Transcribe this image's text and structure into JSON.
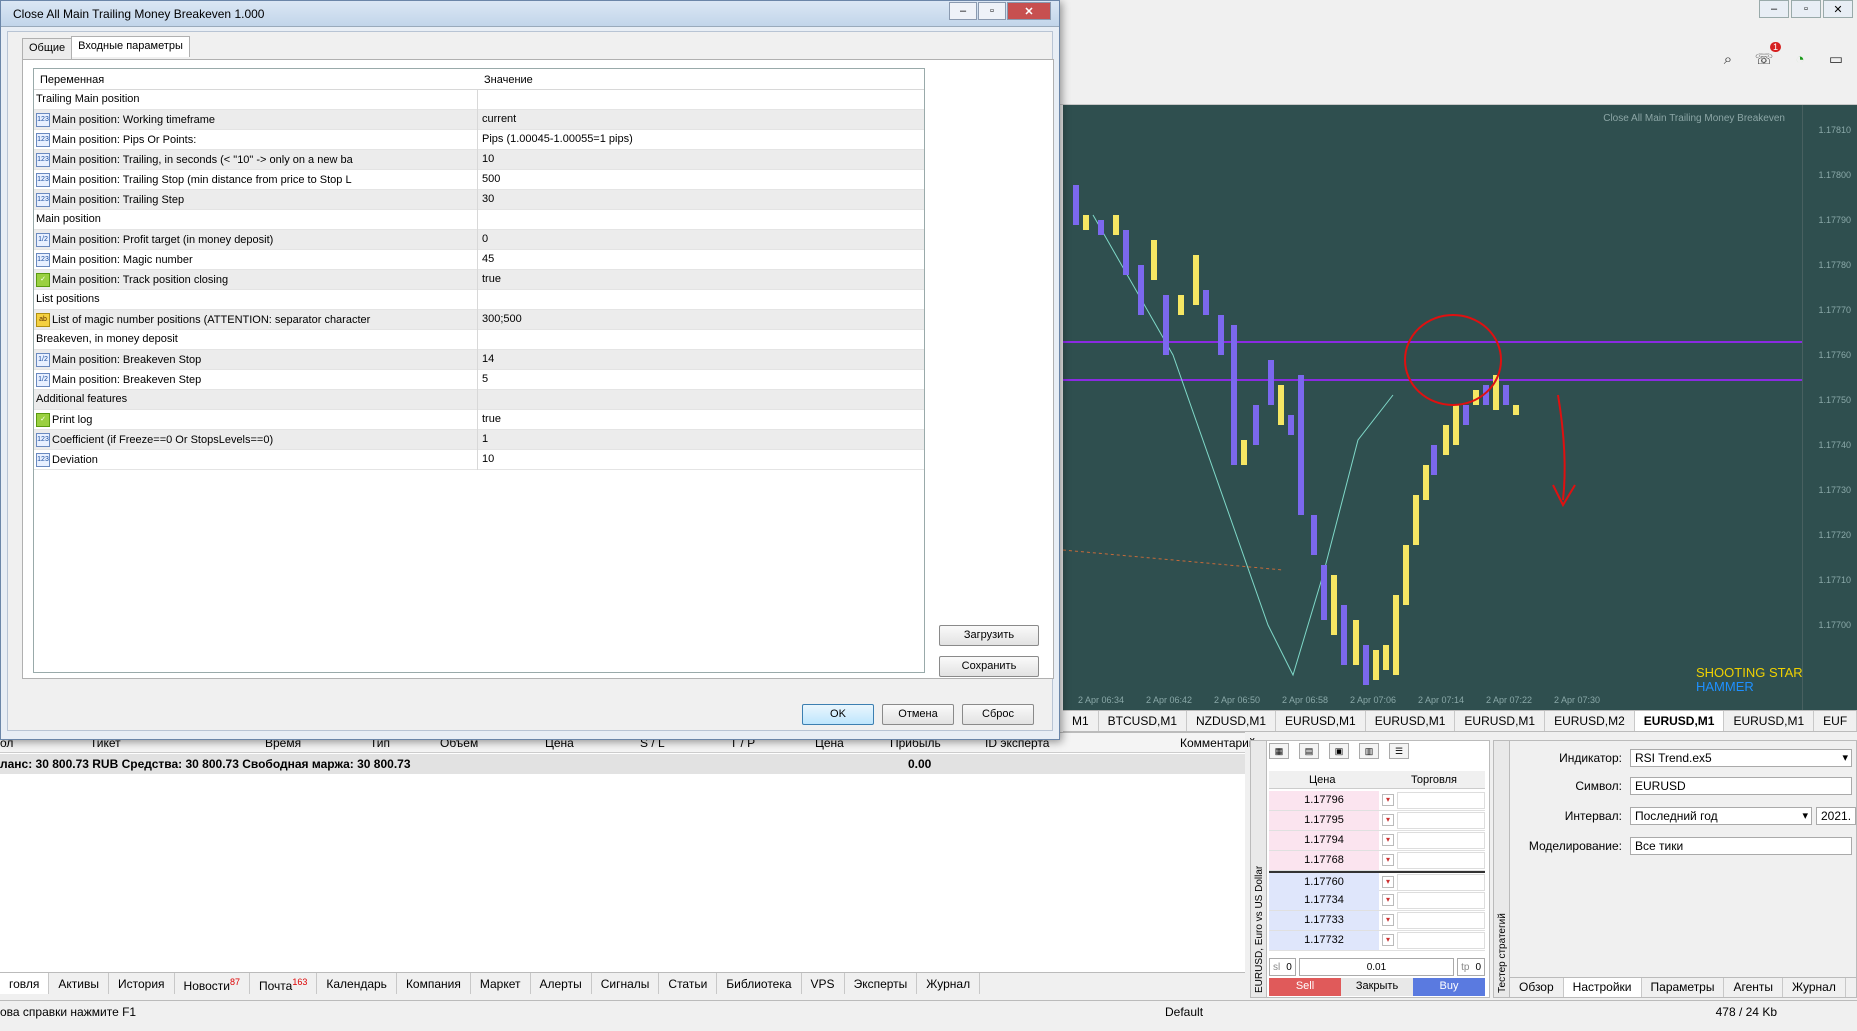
{
  "dialog": {
    "title": "Close All Main Trailing Money Breakeven 1.000",
    "tabs": [
      "Общие",
      "Входные параметры"
    ],
    "columns": {
      "name": "Переменная",
      "value": "Значение"
    },
    "rows": [
      {
        "type": "group",
        "name": "Trailing Main position",
        "value": ""
      },
      {
        "type": "int",
        "name": "Main position: Working timeframe",
        "value": "current"
      },
      {
        "type": "int",
        "name": "Main position: Pips Or Points:",
        "value": "Pips (1.00045-1.00055=1 pips)"
      },
      {
        "type": "int",
        "name": "Main position: Trailing, in seconds (< \"10\" -> only on a new ba",
        "value": "10"
      },
      {
        "type": "int",
        "name": "Main position: Trailing Stop (min distance from price to Stop L",
        "value": "500"
      },
      {
        "type": "int",
        "name": "Main position: Trailing Step",
        "value": "30"
      },
      {
        "type": "group",
        "name": "Main position",
        "value": ""
      },
      {
        "type": "dbl",
        "name": "Main position: Profit target (in money deposit)",
        "value": "0"
      },
      {
        "type": "int",
        "name": "Main position: Magic number",
        "value": "45"
      },
      {
        "type": "bool",
        "name": "Main position: Track position closing",
        "value": "true"
      },
      {
        "type": "group",
        "name": "List positions",
        "value": ""
      },
      {
        "type": "str",
        "name": "List of magic number positions (ATTENTION: separator character",
        "value": "300;500"
      },
      {
        "type": "group",
        "name": "Breakeven, in money deposit",
        "value": ""
      },
      {
        "type": "dbl",
        "name": "Main position: Breakeven Stop",
        "value": "14"
      },
      {
        "type": "dbl",
        "name": "Main position: Breakeven Step",
        "value": "5"
      },
      {
        "type": "group",
        "name": "Additional features",
        "value": ""
      },
      {
        "type": "bool",
        "name": "Print log",
        "value": "true"
      },
      {
        "type": "int",
        "name": "Coefficient (if Freeze==0 Or StopsLevels==0)",
        "value": "1"
      },
      {
        "type": "int",
        "name": "Deviation",
        "value": "10"
      }
    ],
    "load_button": "Загрузить",
    "save_button": "Сохранить",
    "ok_button": "OK",
    "cancel_button": "Отмена",
    "reset_button": "Сброс"
  },
  "type_icons": {
    "int": "123",
    "dbl": "1/2",
    "bool": "✓",
    "str": "ab"
  },
  "chart": {
    "ea_label": "Close All Main Trailing Money Breakeven",
    "pattern_1": "SHOOTING STAR",
    "pattern_2": "HAMMER",
    "price_ticks": [
      "1.17810",
      "1.17800",
      "1.17790",
      "1.17780",
      "1.17770",
      "1.17760",
      "1.17750",
      "1.17740",
      "1.17730",
      "1.17720",
      "1.17710",
      "1.17700"
    ],
    "time_ticks": [
      "2 Apr 06:34",
      "2 Apr 06:42",
      "2 Apr 06:50",
      "2 Apr 06:58",
      "2 Apr 07:06",
      "2 Apr 07:14",
      "2 Apr 07:22",
      "2 Apr 07:30"
    ],
    "colors": {
      "bg": "#2f4f4f",
      "bull": "#f5e663",
      "bear": "#7b68ee",
      "line": "#7fd8c8",
      "hline": "#8a2be2",
      "annot": "#e01010"
    }
  },
  "chart_tabs": [
    "M1",
    "BTCUSD,M1",
    "NZDUSD,M1",
    "EURUSD,M1",
    "EURUSD,M1",
    "EURUSD,M1",
    "EURUSD,M2",
    "EURUSD,M1",
    "EURUSD,M1",
    "EUF"
  ],
  "active_chart_tab": 7,
  "toolbox": {
    "columns": [
      "ол",
      "Тикет",
      "Время",
      "Тип",
      "Объем",
      "Цена",
      "S / L",
      "T / P",
      "Цена",
      "Прибыль",
      "ID эксперта",
      "Комментарий"
    ],
    "balance_text": "ланс: 30 800.73 RUB  Средства: 30 800.73  Свободная маржа: 30 800.73",
    "profit": "0.00"
  },
  "bottom_tabs": [
    {
      "label": "говля",
      "badge": ""
    },
    {
      "label": "Активы",
      "badge": ""
    },
    {
      "label": "История",
      "badge": ""
    },
    {
      "label": "Новости",
      "badge": "87"
    },
    {
      "label": "Почта",
      "badge": "163"
    },
    {
      "label": "Календарь",
      "badge": ""
    },
    {
      "label": "Компания",
      "badge": ""
    },
    {
      "label": "Маркет",
      "badge": ""
    },
    {
      "label": "Алерты",
      "badge": ""
    },
    {
      "label": "Сигналы",
      "badge": ""
    },
    {
      "label": "Статьи",
      "badge": ""
    },
    {
      "label": "Библиотека",
      "badge": ""
    },
    {
      "label": "VPS",
      "badge": ""
    },
    {
      "label": "Эксперты",
      "badge": ""
    },
    {
      "label": "Журнал",
      "badge": ""
    }
  ],
  "status": {
    "help": "ова справки нажмите F1",
    "profile": "Default",
    "net": "478 / 24 Kb"
  },
  "dom": {
    "vertical_label": "EURUSD, Euro vs US Dollar",
    "price_header": "Цена",
    "trade_header": "Торговля",
    "asks": [
      "1.17796",
      "1.17795",
      "1.17794",
      "1.17768"
    ],
    "bids": [
      "1.17760",
      "1.17734",
      "1.17733",
      "1.17732"
    ],
    "sl_label": "sl",
    "sl_value": "0",
    "volume": "0.01",
    "tp_label": "tp",
    "tp_value": "0",
    "sell": "Sell",
    "close": "Закрыть",
    "buy": "Buy"
  },
  "tester": {
    "vertical_label": "Тестер стратегий",
    "indicator_label": "Индикатор:",
    "indicator_value": "RSI Trend.ex5",
    "symbol_label": "Символ:",
    "symbol_value": "EURUSD",
    "interval_label": "Интервал:",
    "interval_value": "Последний год",
    "interval_extra": "2021.",
    "model_label": "Моделирование:",
    "model_value": "Все тики",
    "tabs": [
      "Обзор",
      "Настройки",
      "Параметры",
      "Агенты",
      "Журнал"
    ],
    "active_tab": 1
  },
  "toolbar_badge": "1"
}
